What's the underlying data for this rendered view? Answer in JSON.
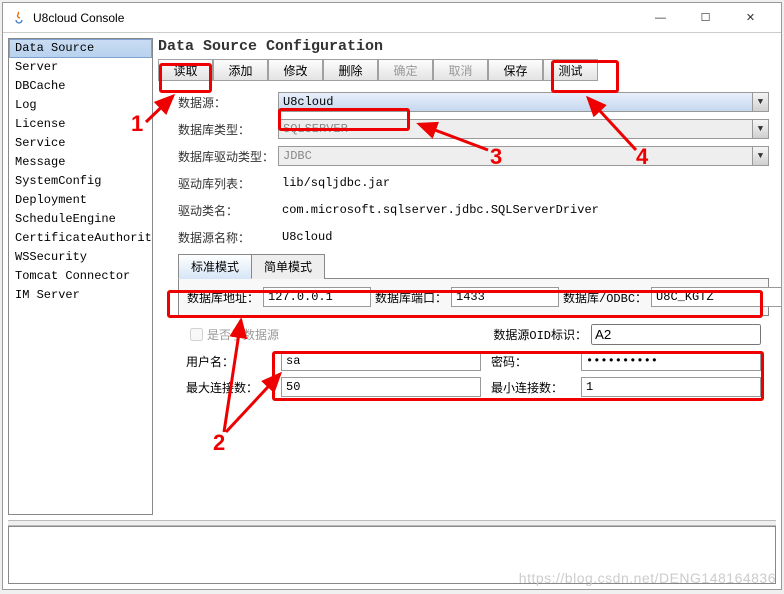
{
  "window": {
    "title": "U8cloud Console"
  },
  "sidebar": {
    "items": [
      {
        "label": "Data Source",
        "selected": true
      },
      {
        "label": "Server"
      },
      {
        "label": "DBCache"
      },
      {
        "label": "Log"
      },
      {
        "label": "License"
      },
      {
        "label": "Service"
      },
      {
        "label": "Message"
      },
      {
        "label": "SystemConfig"
      },
      {
        "label": "Deployment"
      },
      {
        "label": "ScheduleEngine"
      },
      {
        "label": "CertificateAuthority"
      },
      {
        "label": "WSSecurity"
      },
      {
        "label": "Tomcat Connector"
      },
      {
        "label": "IM Server"
      }
    ]
  },
  "page": {
    "title": "Data Source Configuration"
  },
  "toolbar": {
    "read": "读取",
    "add": "添加",
    "modify": "修改",
    "delete": "删除",
    "ok": "确定",
    "cancel": "取消",
    "save": "保存",
    "test": "测试"
  },
  "fields": {
    "datasource_label": "数据源：",
    "datasource_value": "U8cloud",
    "dbtype_label": "数据库类型：",
    "dbtype_value": "SQLSERVER",
    "drivertype_label": "数据库驱动类型：",
    "drivertype_value": "JDBC",
    "driverlib_label": "驱动库列表：",
    "driverlib_value": "lib/sqljdbc.jar",
    "driverclass_label": "驱动类名：",
    "driverclass_value": "com.microsoft.sqlserver.jdbc.SQLServerDriver",
    "dsname_label": "数据源名称：",
    "dsname_value": "U8cloud"
  },
  "tabs": {
    "standard": "标准模式",
    "simple": "简单模式"
  },
  "conn": {
    "addr_label": "数据库地址：",
    "addr_value": "127.0.0.1",
    "port_label": "数据库端口：",
    "port_value": "1433",
    "odbc_label": "数据库/ODBC：",
    "odbc_value": "U8C_KGTZ"
  },
  "opts": {
    "sub_ds_label": "是否子数据源",
    "oid_label": "数据源OID标识：",
    "oid_value": "A2",
    "user_label": "用户名：",
    "user_value": "sa",
    "pwd_label": "密码：",
    "pwd_value": "••••••••••",
    "max_label": "最大连接数：",
    "max_value": "50",
    "min_label": "最小连接数：",
    "min_value": "1"
  },
  "annotations": {
    "n1": "1",
    "n2": "2",
    "n3": "3",
    "n4": "4"
  },
  "watermark": "https://blog.csdn.net/DENG148164836"
}
